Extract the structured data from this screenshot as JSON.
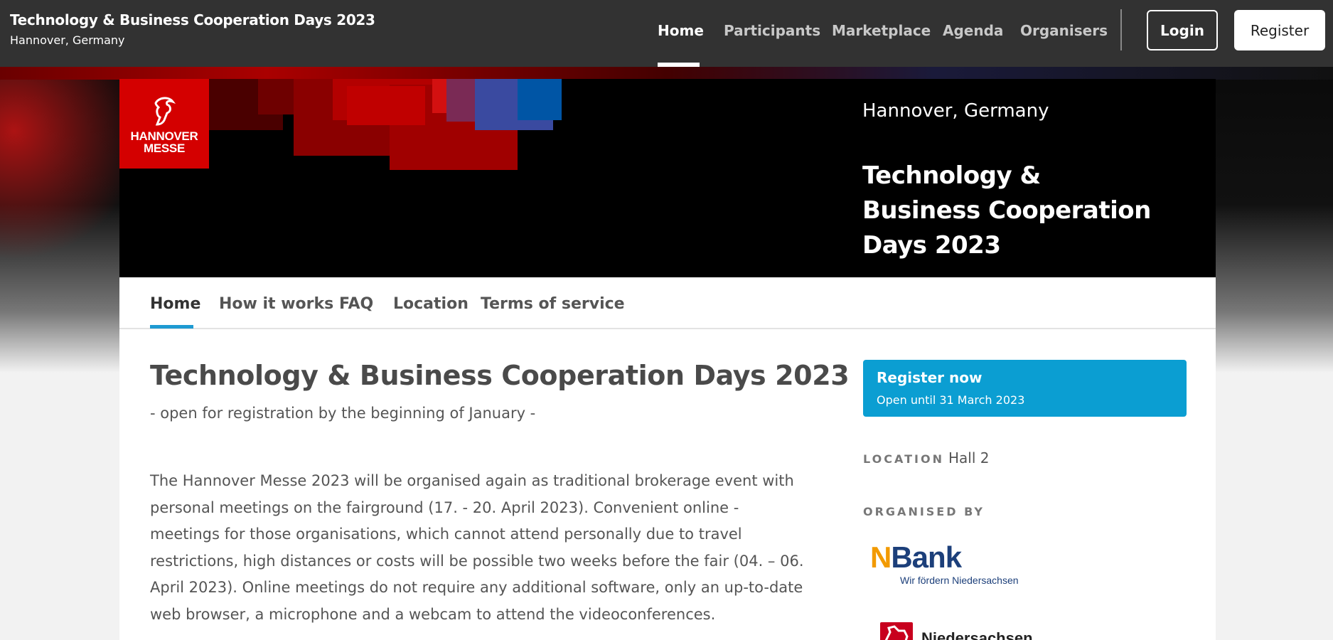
{
  "header": {
    "title": "Technology & Business Cooperation Days 2023",
    "subtitle": "Hannover, Germany",
    "nav": [
      "Home",
      "Participants",
      "Marketplace",
      "Agenda",
      "Organisers"
    ],
    "login_label": "Login",
    "register_label": "Register"
  },
  "banner": {
    "logo_text_line1": "HANNOVER",
    "logo_text_line2": "MESSE",
    "location": "Hannover, Germany",
    "title": "Technology & Business Cooperation Days 2023"
  },
  "subnav": [
    "Home",
    "How it works",
    "FAQ",
    "Location",
    "Terms of service"
  ],
  "main": {
    "title": "Technology & Business Cooperation Days 2023",
    "subtitle": "- open for registration by the beginning of January -",
    "body": "The Hannover Messe 2023 will be organised again as traditional brokerage event with personal meetings on the fairground (17. - 20. April 2023). Convenient online -meetings for those organisations, which cannot attend personally due to travel restrictions, high distances or costs will be possible two weeks before the fair (04. – 06. April 2023). Online meetings do not require any additional software, only an up-to-date web browser, a microphone and a webcam to attend the videoconferences."
  },
  "sidebar": {
    "register_title": "Register now",
    "register_sub": "Open until 31 March 2023",
    "location_label": "LOCATION",
    "location_value": "Hall 2",
    "organised_label": "ORGANISED BY",
    "organisers": [
      {
        "name_first": "N",
        "name_rest": "Bank",
        "tagline": "Wir fördern Niedersachsen"
      },
      {
        "name": "Niedersachsen"
      }
    ]
  },
  "colors": {
    "topbar": "#323232",
    "accent": "#0b9ed2",
    "logo_red": "#d40000",
    "nbank_blue": "#1c3f7a",
    "nbank_orange": "#f29a00"
  }
}
